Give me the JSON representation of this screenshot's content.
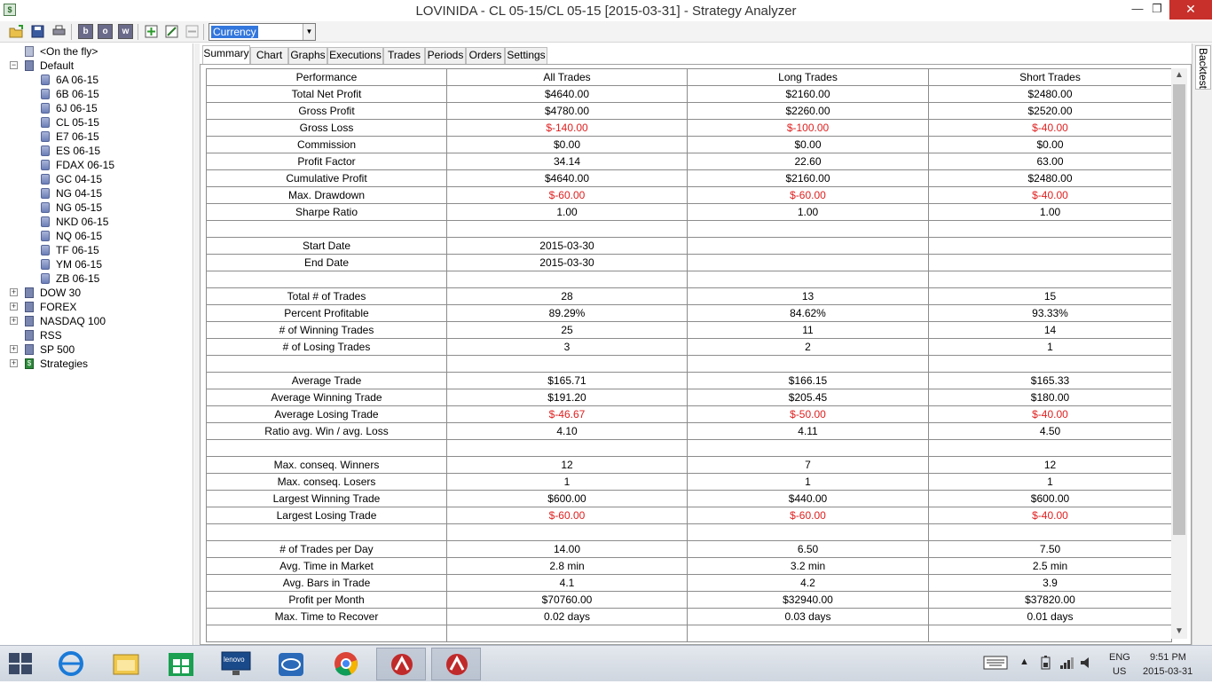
{
  "window": {
    "title": "LOVINIDA - CL 05-15/CL 05-15 [2015-03-31] - Strategy Analyzer",
    "min_glyph": "—",
    "max_glyph": "❐",
    "close_glyph": "✕"
  },
  "toolbar": {
    "buttons": [
      "open-folder-icon",
      "save-icon",
      "print-icon",
      "b",
      "o",
      "w",
      "add-icon",
      "edit-icon",
      "remove-icon"
    ],
    "currency_value": "Currency"
  },
  "tree": {
    "on_the_fly": "<On the fly>",
    "default_label": "Default",
    "default_children": [
      "6A 06-15",
      "6B 06-15",
      "6J 06-15",
      "CL 05-15",
      "E7 06-15",
      "ES 06-15",
      "FDAX 06-15",
      "GC 04-15",
      "NG 04-15",
      "NG 05-15",
      "NKD 06-15",
      "NQ 06-15",
      "TF 06-15",
      "YM 06-15",
      "ZB 06-15"
    ],
    "groups": [
      "DOW 30",
      "FOREX",
      "NASDAQ 100",
      "RSS",
      "SP 500",
      "Strategies"
    ]
  },
  "tabs": [
    "Summary",
    "Chart",
    "Graphs",
    "Executions",
    "Trades",
    "Periods",
    "Orders",
    "Settings"
  ],
  "right_tab": "Backtest",
  "grid": {
    "headers": [
      "Performance",
      "All Trades",
      "Long Trades",
      "Short Trades"
    ],
    "rows": [
      {
        "label": "Total Net Profit",
        "all": "$4640.00",
        "long": "$2160.00",
        "short": "$2480.00"
      },
      {
        "label": "Gross Profit",
        "all": "$4780.00",
        "long": "$2260.00",
        "short": "$2520.00"
      },
      {
        "label": "Gross Loss",
        "all": "$-140.00",
        "long": "$-100.00",
        "short": "$-40.00",
        "neg": true
      },
      {
        "label": "Commission",
        "all": "$0.00",
        "long": "$0.00",
        "short": "$0.00"
      },
      {
        "label": "Profit Factor",
        "all": "34.14",
        "long": "22.60",
        "short": "63.00"
      },
      {
        "label": "Cumulative Profit",
        "all": "$4640.00",
        "long": "$2160.00",
        "short": "$2480.00"
      },
      {
        "label": "Max. Drawdown",
        "all": "$-60.00",
        "long": "$-60.00",
        "short": "$-40.00",
        "neg": true
      },
      {
        "label": "Sharpe Ratio",
        "all": "1.00",
        "long": "1.00",
        "short": "1.00"
      },
      {
        "label": "",
        "all": "",
        "long": "",
        "short": ""
      },
      {
        "label": "Start Date",
        "all": "2015-03-30",
        "long": "",
        "short": ""
      },
      {
        "label": "End Date",
        "all": "2015-03-30",
        "long": "",
        "short": ""
      },
      {
        "label": "",
        "all": "",
        "long": "",
        "short": ""
      },
      {
        "label": "Total # of Trades",
        "all": "28",
        "long": "13",
        "short": "15"
      },
      {
        "label": "Percent Profitable",
        "all": "89.29%",
        "long": "84.62%",
        "short": "93.33%"
      },
      {
        "label": "# of Winning Trades",
        "all": "25",
        "long": "11",
        "short": "14"
      },
      {
        "label": "# of Losing Trades",
        "all": "3",
        "long": "2",
        "short": "1"
      },
      {
        "label": "",
        "all": "",
        "long": "",
        "short": ""
      },
      {
        "label": "Average Trade",
        "all": "$165.71",
        "long": "$166.15",
        "short": "$165.33"
      },
      {
        "label": "Average Winning Trade",
        "all": "$191.20",
        "long": "$205.45",
        "short": "$180.00"
      },
      {
        "label": "Average Losing Trade",
        "all": "$-46.67",
        "long": "$-50.00",
        "short": "$-40.00",
        "neg": true
      },
      {
        "label": "Ratio avg. Win / avg. Loss",
        "all": "4.10",
        "long": "4.11",
        "short": "4.50"
      },
      {
        "label": "",
        "all": "",
        "long": "",
        "short": ""
      },
      {
        "label": "Max. conseq. Winners",
        "all": "12",
        "long": "7",
        "short": "12"
      },
      {
        "label": "Max. conseq. Losers",
        "all": "1",
        "long": "1",
        "short": "1"
      },
      {
        "label": "Largest Winning Trade",
        "all": "$600.00",
        "long": "$440.00",
        "short": "$600.00"
      },
      {
        "label": "Largest Losing Trade",
        "all": "$-60.00",
        "long": "$-60.00",
        "short": "$-40.00",
        "neg": true
      },
      {
        "label": "",
        "all": "",
        "long": "",
        "short": ""
      },
      {
        "label": "# of Trades per Day",
        "all": "14.00",
        "long": "6.50",
        "short": "7.50"
      },
      {
        "label": "Avg. Time in Market",
        "all": "2.8 min",
        "long": "3.2 min",
        "short": "2.5 min"
      },
      {
        "label": "Avg. Bars in Trade",
        "all": "4.1",
        "long": "4.2",
        "short": "3.9"
      },
      {
        "label": "Profit per Month",
        "all": "$70760.00",
        "long": "$32940.00",
        "short": "$37820.00"
      },
      {
        "label": "Max. Time to Recover",
        "all": "0.02 days",
        "long": "0.03 days",
        "short": "0.01 days"
      },
      {
        "label": "",
        "all": "",
        "long": "",
        "short": ""
      }
    ],
    "negative_color": "#e02020"
  },
  "taskbar": {
    "apps": [
      "internet-explorer-icon",
      "file-explorer-icon",
      "store-icon",
      "lenovo-icon",
      "intel-icon",
      "chrome-icon",
      "ninjatrader-icon",
      "ninjatrader-icon"
    ],
    "lenovo_text": "lenovo",
    "lang": "ENG",
    "region": "US",
    "time": "9:51 PM",
    "date": "2015-03-31"
  }
}
